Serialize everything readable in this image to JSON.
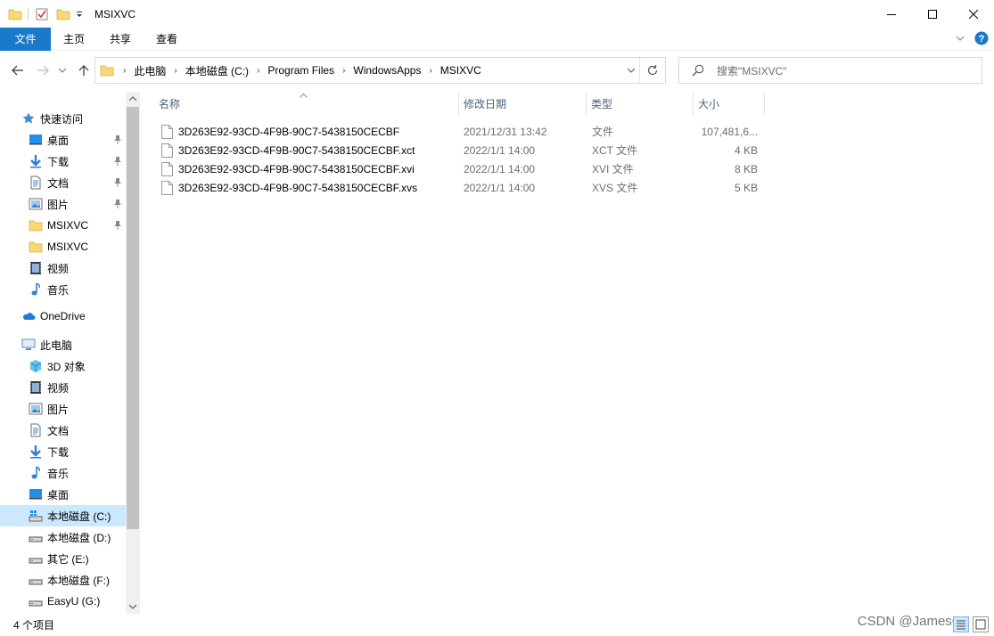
{
  "window": {
    "title": "MSIXVC",
    "minimize_glyph": "─",
    "maximize_glyph": "☐",
    "close_glyph": "✕"
  },
  "ribbon": {
    "tabs": [
      {
        "label": "文件"
      },
      {
        "label": "主页"
      },
      {
        "label": "共享"
      },
      {
        "label": "查看"
      }
    ],
    "expand_glyph": "⌄",
    "help_glyph": "?"
  },
  "address": {
    "crumbs": [
      "此电脑",
      "本地磁盘 (C:)",
      "Program Files",
      "WindowsApps",
      "MSIXVC"
    ]
  },
  "search": {
    "placeholder": "搜索\"MSIXVC\""
  },
  "sidebar": {
    "quick_access": "快速访问",
    "items_quick": [
      {
        "label": "桌面",
        "icon": "desktop-icon",
        "pinned": true
      },
      {
        "label": "下载",
        "icon": "download-icon",
        "pinned": true
      },
      {
        "label": "文档",
        "icon": "document-icon",
        "pinned": true
      },
      {
        "label": "图片",
        "icon": "pictures-icon",
        "pinned": true
      },
      {
        "label": "MSIXVC",
        "icon": "folder-icon",
        "pinned": true
      },
      {
        "label": "MSIXVC",
        "icon": "folder-icon",
        "pinned": false
      },
      {
        "label": "视频",
        "icon": "video-icon",
        "pinned": false
      },
      {
        "label": "音乐",
        "icon": "music-icon",
        "pinned": false
      }
    ],
    "onedrive": "OneDrive",
    "this_pc": "此电脑",
    "items_pc": [
      {
        "label": "3D 对象",
        "icon": "3d-objects-icon"
      },
      {
        "label": "视频",
        "icon": "video-icon"
      },
      {
        "label": "图片",
        "icon": "pictures-icon"
      },
      {
        "label": "文档",
        "icon": "document-icon"
      },
      {
        "label": "下载",
        "icon": "download-icon"
      },
      {
        "label": "音乐",
        "icon": "music-icon"
      },
      {
        "label": "桌面",
        "icon": "desktop-icon"
      },
      {
        "label": "本地磁盘 (C:)",
        "icon": "drive-c-icon",
        "selected": true
      },
      {
        "label": "本地磁盘 (D:)",
        "icon": "drive-icon"
      },
      {
        "label": "其它 (E:)",
        "icon": "drive-icon"
      },
      {
        "label": "本地磁盘 (F:)",
        "icon": "drive-icon"
      },
      {
        "label": "EasyU (G:)",
        "icon": "drive-icon"
      }
    ]
  },
  "columns": {
    "name": "名称",
    "date": "修改日期",
    "type": "类型",
    "size": "大小"
  },
  "files": [
    {
      "name": "3D263E92-93CD-4F9B-90C7-5438150CECBF",
      "date": "2021/12/31 13:42",
      "type": "文件",
      "size": "107,481,6..."
    },
    {
      "name": "3D263E92-93CD-4F9B-90C7-5438150CECBF.xct",
      "date": "2022/1/1 14:00",
      "type": "XCT 文件",
      "size": "4 KB"
    },
    {
      "name": "3D263E92-93CD-4F9B-90C7-5438150CECBF.xvi",
      "date": "2022/1/1 14:00",
      "type": "XVI 文件",
      "size": "8 KB"
    },
    {
      "name": "3D263E92-93CD-4F9B-90C7-5438150CECBF.xvs",
      "date": "2022/1/1 14:00",
      "type": "XVS 文件",
      "size": "5 KB"
    }
  ],
  "status": {
    "count": "4 个项目"
  },
  "watermark": "CSDN @JamesCu",
  "colors": {
    "accent": "#1979ca",
    "selection": "#cce8ff",
    "header_text": "#4c607a",
    "muted_text": "#6d6d6d"
  }
}
